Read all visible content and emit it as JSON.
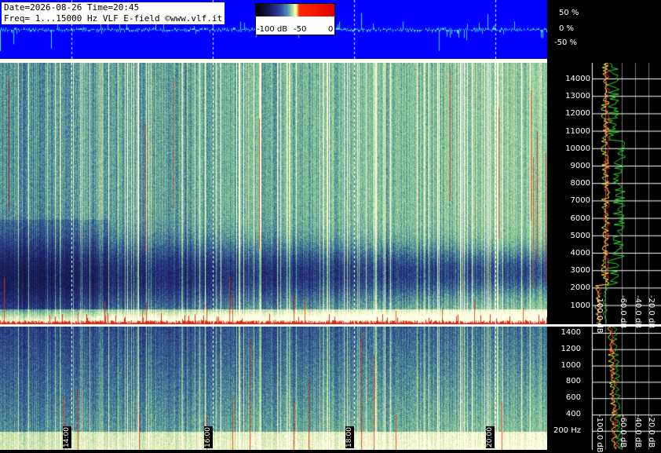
{
  "info": {
    "line1": "Date=2026-08-26 Time=20:45",
    "line2": "Freq= 1...15000 Hz   VLF E-field ©www.vlf.it"
  },
  "colorbar": {
    "labels": [
      "-100 dB",
      "-50",
      "0"
    ]
  },
  "waveform": {
    "labels": [
      "50 %",
      "0 %",
      "-50 %"
    ],
    "color": "#3fe0ff",
    "background": "#0000ff"
  },
  "upper_freq_axis": {
    "labels": [
      "14000",
      "13000",
      "12000",
      "11000",
      "10000",
      "9000",
      "8000",
      "7000",
      "6000",
      "5000",
      "4000",
      "3000",
      "2000",
      "1000"
    ]
  },
  "lower_freq_axis": {
    "labels": [
      "1400",
      "1200",
      "1000",
      "800",
      "600",
      "400",
      "200 Hz"
    ]
  },
  "time_labels": [
    "14:00",
    "16:00",
    "18:00",
    "20:00"
  ],
  "spectrum_db_labels_upper": [
    "-100.0 dB",
    "-60.0 dB",
    "-40.0 dB",
    "-20.0 dB"
  ],
  "spectrum_db_labels_lower": [
    "-100.0 dB",
    "-60.0 dB",
    "-40.0 dB",
    "-20.0 dB"
  ],
  "colors": {
    "spectrogram_low": "#1c2466",
    "spectrogram_mid": "#6fb59a",
    "spectrogram_high": "#f4f6c8",
    "spike": "#e02a10",
    "trace_green": "#2fd12f",
    "trace_yellow": "#f0e040",
    "trace_red": "#ff2a2a"
  }
}
